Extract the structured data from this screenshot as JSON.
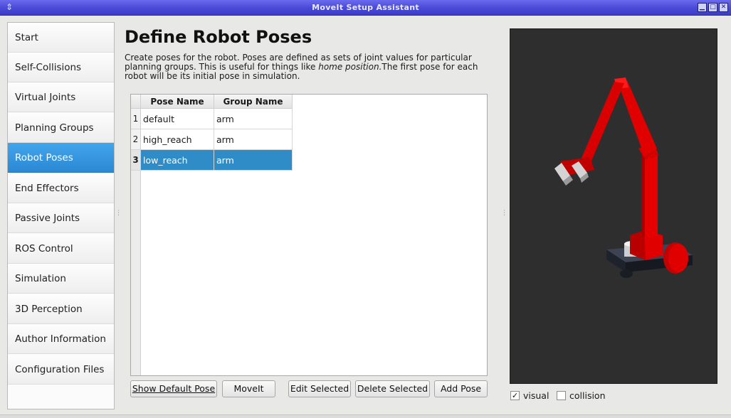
{
  "window": {
    "title": "MoveIt Setup Assistant",
    "controls": [
      "minimize-icon",
      "maximize-icon",
      "close-icon"
    ]
  },
  "sidebar": {
    "items": [
      {
        "label": "Start",
        "active": false
      },
      {
        "label": "Self-Collisions",
        "active": false
      },
      {
        "label": "Virtual Joints",
        "active": false
      },
      {
        "label": "Planning Groups",
        "active": false
      },
      {
        "label": "Robot Poses",
        "active": true
      },
      {
        "label": "End Effectors",
        "active": false
      },
      {
        "label": "Passive Joints",
        "active": false
      },
      {
        "label": "ROS Control",
        "active": false
      },
      {
        "label": "Simulation",
        "active": false
      },
      {
        "label": "3D Perception",
        "active": false
      },
      {
        "label": "Author Information",
        "active": false
      },
      {
        "label": "Configuration Files",
        "active": false
      }
    ]
  },
  "main": {
    "title": "Define Robot Poses",
    "description_before": "Create poses for the robot. Poses are defined as sets of joint values for particular planning groups. This is useful for things like ",
    "description_em": "home position.",
    "description_after": "The first pose for each robot will be its initial pose in simulation.",
    "table": {
      "columns": [
        "Pose Name",
        "Group Name"
      ],
      "rows": [
        {
          "num": "1",
          "pose": "default",
          "group": "arm",
          "selected": false
        },
        {
          "num": "2",
          "pose": "high_reach",
          "group": "arm",
          "selected": false
        },
        {
          "num": "3",
          "pose": "low_reach",
          "group": "arm",
          "selected": true
        }
      ]
    },
    "buttons": {
      "show_default": "Show Default Pose",
      "moveit": "MoveIt",
      "edit": "Edit Selected",
      "delete": "Delete Selected",
      "add": "Add Pose"
    }
  },
  "viewer": {
    "visual_label": "visual",
    "visual_checked": true,
    "collision_label": "collision",
    "collision_checked": false
  },
  "colors": {
    "accent": "#2b88d3",
    "selection": "#308cc6",
    "robot": "#e00000"
  }
}
